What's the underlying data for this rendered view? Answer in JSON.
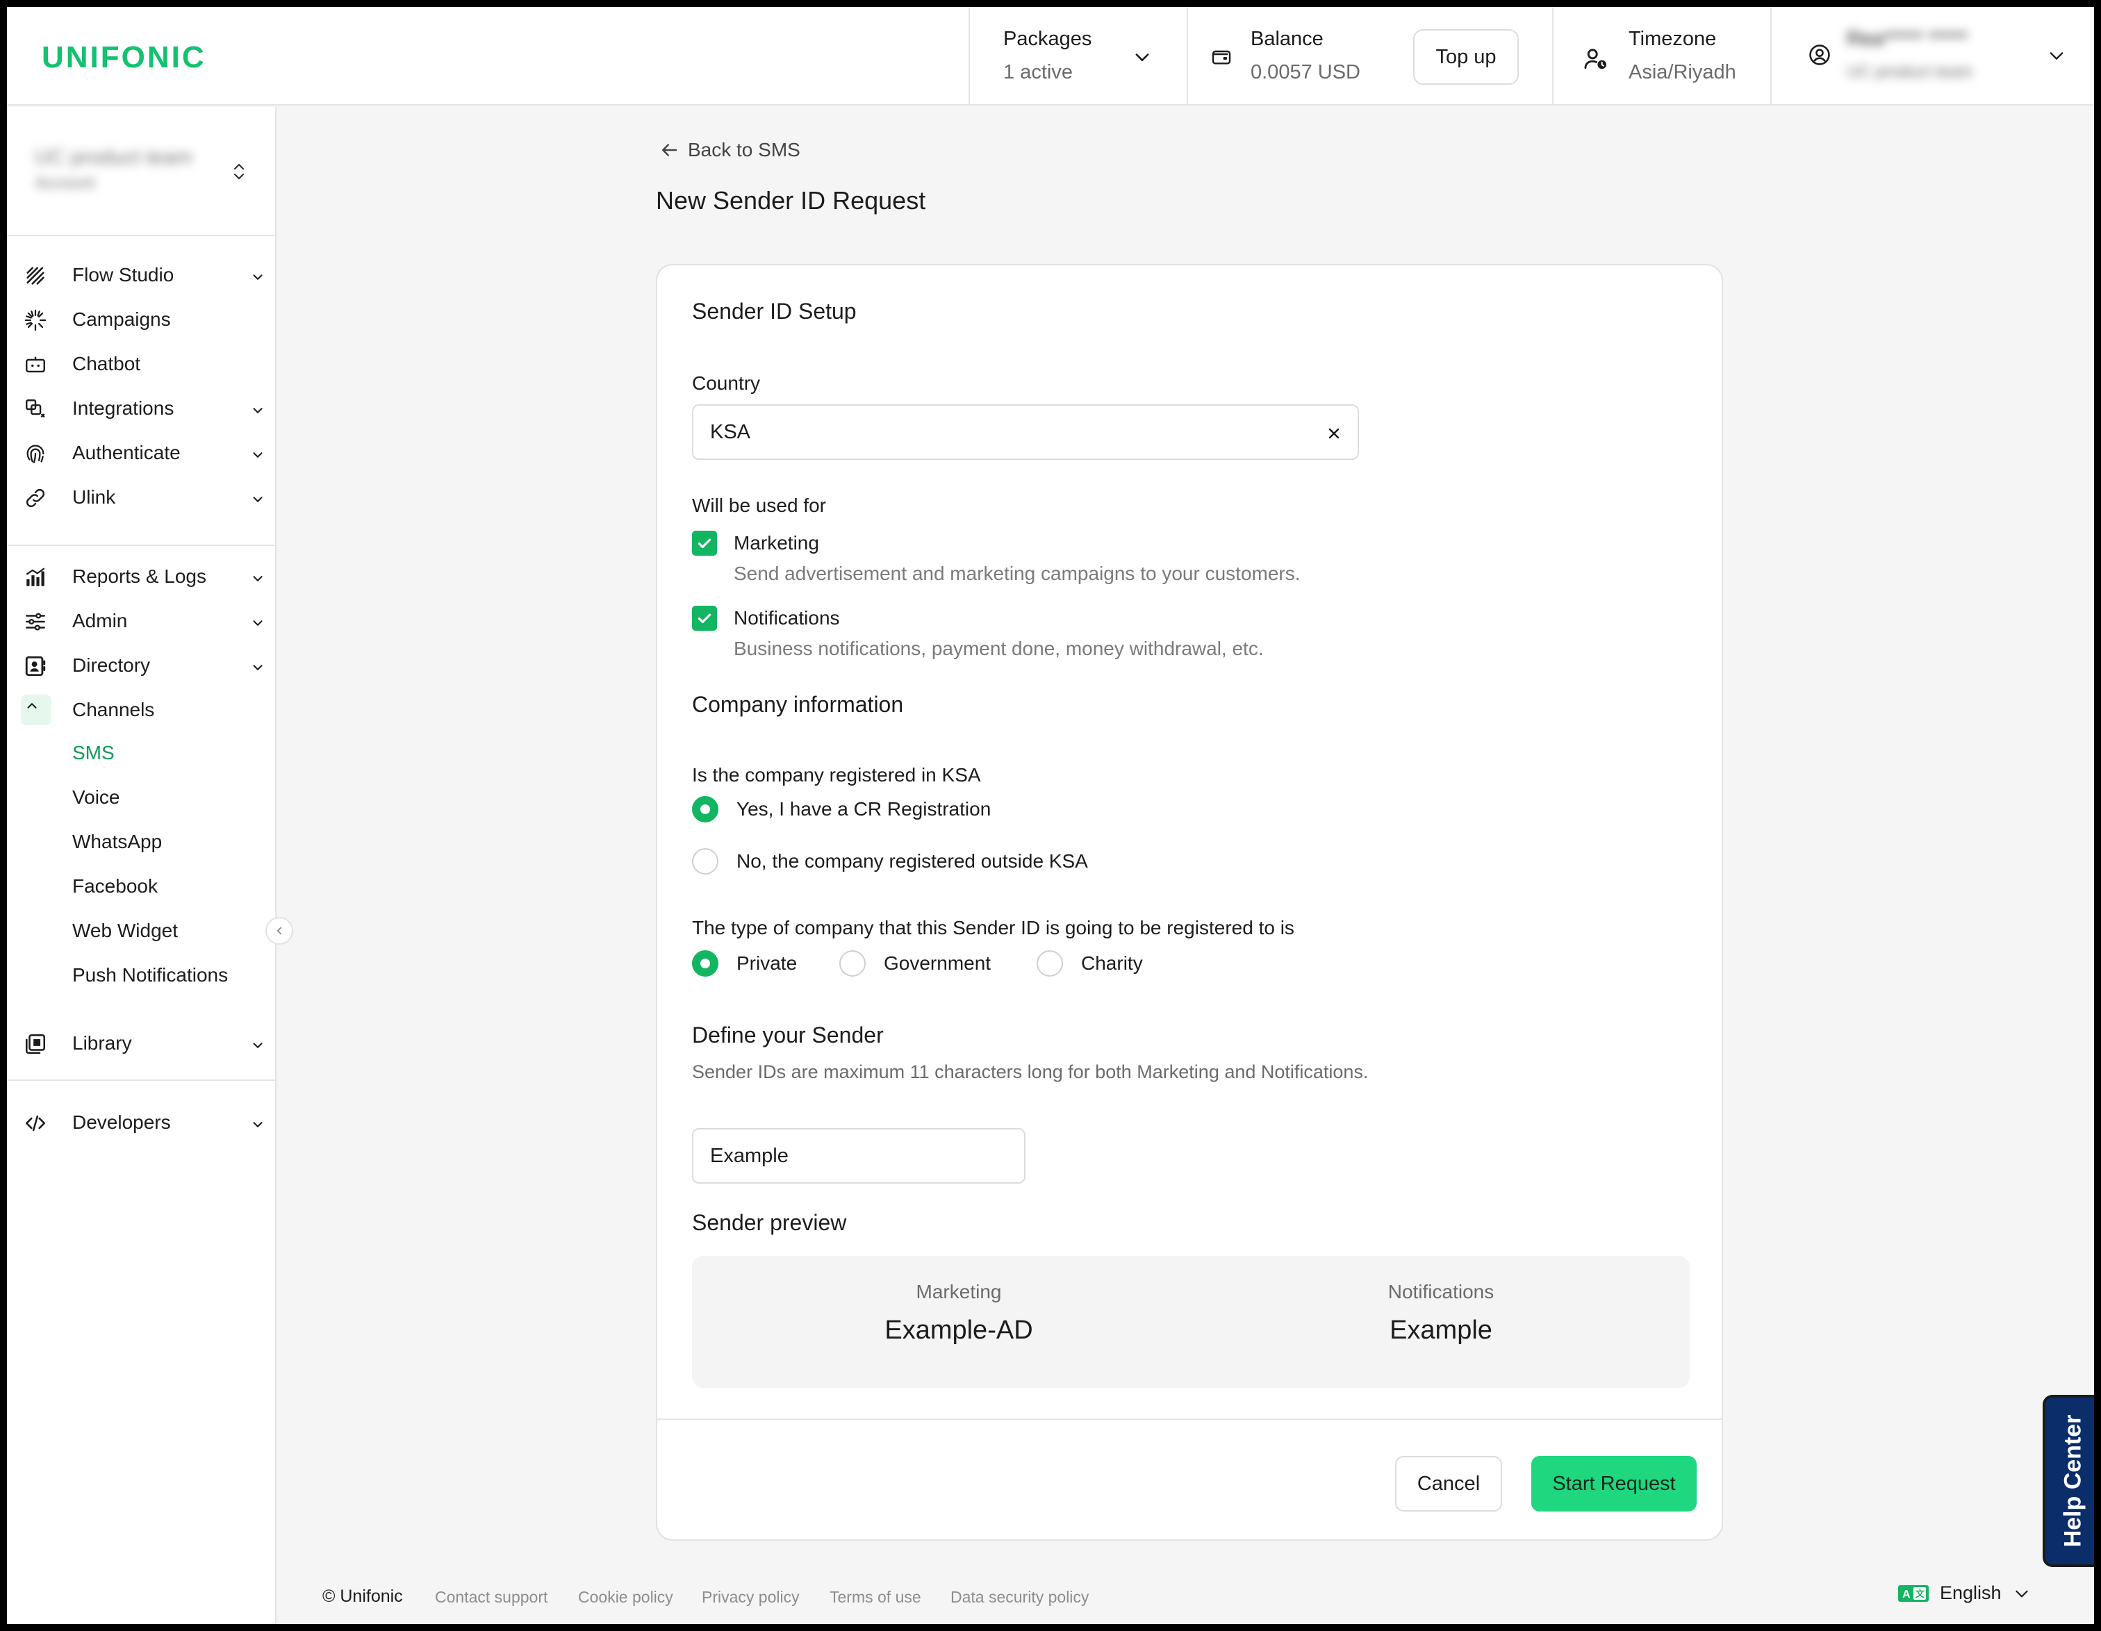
{
  "brand": {
    "logo": "UNIFONIC",
    "accent": "#12c26e"
  },
  "header": {
    "packages": {
      "title": "Packages",
      "value": "1 active"
    },
    "balance": {
      "title": "Balance",
      "value": "0.0057 USD",
      "topup": "Top up"
    },
    "timezone": {
      "title": "Timezone",
      "value": "Asia/Riyadh"
    },
    "user": {
      "name": "Rea***** *****",
      "account": "UC product team"
    }
  },
  "sidebar": {
    "account": {
      "name": "UC product team",
      "sub": "Account"
    },
    "items": [
      {
        "label": "Flow Studio",
        "icon": "flow-studio-icon"
      },
      {
        "label": "Campaigns",
        "icon": "campaigns-icon"
      },
      {
        "label": "Chatbot",
        "icon": "chatbot-icon"
      },
      {
        "label": "Integrations",
        "icon": "integrations-icon"
      },
      {
        "label": "Authenticate",
        "icon": "fingerprint-icon"
      },
      {
        "label": "Ulink",
        "icon": "link-icon"
      },
      {
        "label": "Reports & Logs",
        "icon": "reports-icon"
      },
      {
        "label": "Admin",
        "icon": "sliders-icon"
      },
      {
        "label": "Directory",
        "icon": "contacts-icon"
      },
      {
        "label": "Channels",
        "icon": "channels-icon"
      },
      {
        "label": "Library",
        "icon": "library-icon"
      },
      {
        "label": "Developers",
        "icon": "code-icon"
      }
    ],
    "channels": [
      "SMS",
      "Voice",
      "WhatsApp",
      "Facebook",
      "Web Widget",
      "Push Notifications"
    ],
    "active_channel": "SMS"
  },
  "main": {
    "back": "Back to SMS",
    "title": "New Sender ID Request",
    "setup_title": "Sender ID Setup",
    "country": {
      "label": "Country",
      "value": "KSA"
    },
    "usage": {
      "label": "Will be used for",
      "options": [
        {
          "title": "Marketing",
          "desc": "Send advertisement and marketing campaigns to your customers.",
          "checked": true
        },
        {
          "title": "Notifications",
          "desc": "Business notifications, payment done, money withdrawal, etc.",
          "checked": true
        }
      ]
    },
    "company": {
      "title": "Company information",
      "registered_q": "Is the company registered in KSA",
      "registered_options": [
        "Yes, I have a CR Registration",
        "No, the company registered outside KSA"
      ],
      "registered_selected": 0,
      "type_q": "The type of company that this Sender ID is going to be registered to is",
      "type_options": [
        "Private",
        "Government",
        "Charity"
      ],
      "type_selected": 0
    },
    "sender": {
      "title": "Define your Sender",
      "helper": "Sender IDs are maximum 11 characters long for both Marketing and Notifications.",
      "value": "Example"
    },
    "preview": {
      "title": "Sender preview",
      "marketing_label": "Marketing",
      "marketing_value": "Example-AD",
      "notifications_label": "Notifications",
      "notifications_value": "Example"
    },
    "buttons": {
      "cancel": "Cancel",
      "start": "Start Request"
    }
  },
  "footer": {
    "copyright": "© Unifonic",
    "links": [
      "Contact support",
      "Cookie policy",
      "Privacy policy",
      "Terms of use",
      "Data security policy"
    ],
    "language": "English",
    "help": "Help Center"
  }
}
